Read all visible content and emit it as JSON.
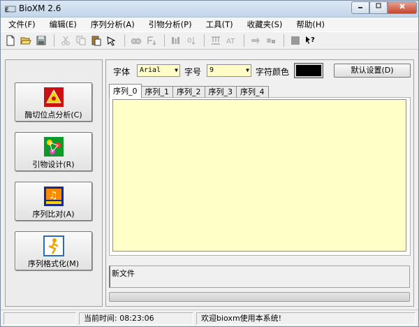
{
  "window": {
    "title": "BioXM 2.6",
    "app_icon_text": "ᵘᴬᴹ"
  },
  "menu": [
    "文件(F)",
    "编辑(E)",
    "序列分析(A)",
    "引物分析(P)",
    "工具(T)",
    "收藏夹(S)",
    "帮助(H)"
  ],
  "toolbar_icons": [
    "new-file-icon",
    "open-folder-icon",
    "save-icon",
    "cut-icon",
    "copy-icon",
    "paste-icon",
    "pointer-icon",
    "find-icon",
    "replace-icon",
    "align-icon",
    "sort-icon",
    "format-icon",
    "translate-icon",
    "export-icon",
    "import-icon",
    "stop-icon",
    "help-pointer-icon"
  ],
  "left_panel": {
    "buttons": [
      {
        "label": "酶切位点分析(C)",
        "icon": "restriction-icon"
      },
      {
        "label": "引物设计(R)",
        "icon": "primer-icon"
      },
      {
        "label": "序列比对(A)",
        "icon": "alignment-icon"
      },
      {
        "label": "序列格式化(M)",
        "icon": "format-run-icon"
      }
    ]
  },
  "settings": {
    "font_label": "字体",
    "font_value": "Arial",
    "size_label": "字号",
    "size_value": "9",
    "color_label": "字符颜色",
    "char_color": "#000000",
    "default_button": "默认设置(D)"
  },
  "tabs": [
    "序列_0",
    "序列_1",
    "序列_2",
    "序列_3",
    "序列_4"
  ],
  "editor": {
    "background": "#ffffc8",
    "content": ""
  },
  "status_box": {
    "text": "新文件"
  },
  "statusbar": {
    "pane1": "",
    "time_label": "当前时间: 08:23:06",
    "message": "欢迎bioxm使用本系统!"
  }
}
